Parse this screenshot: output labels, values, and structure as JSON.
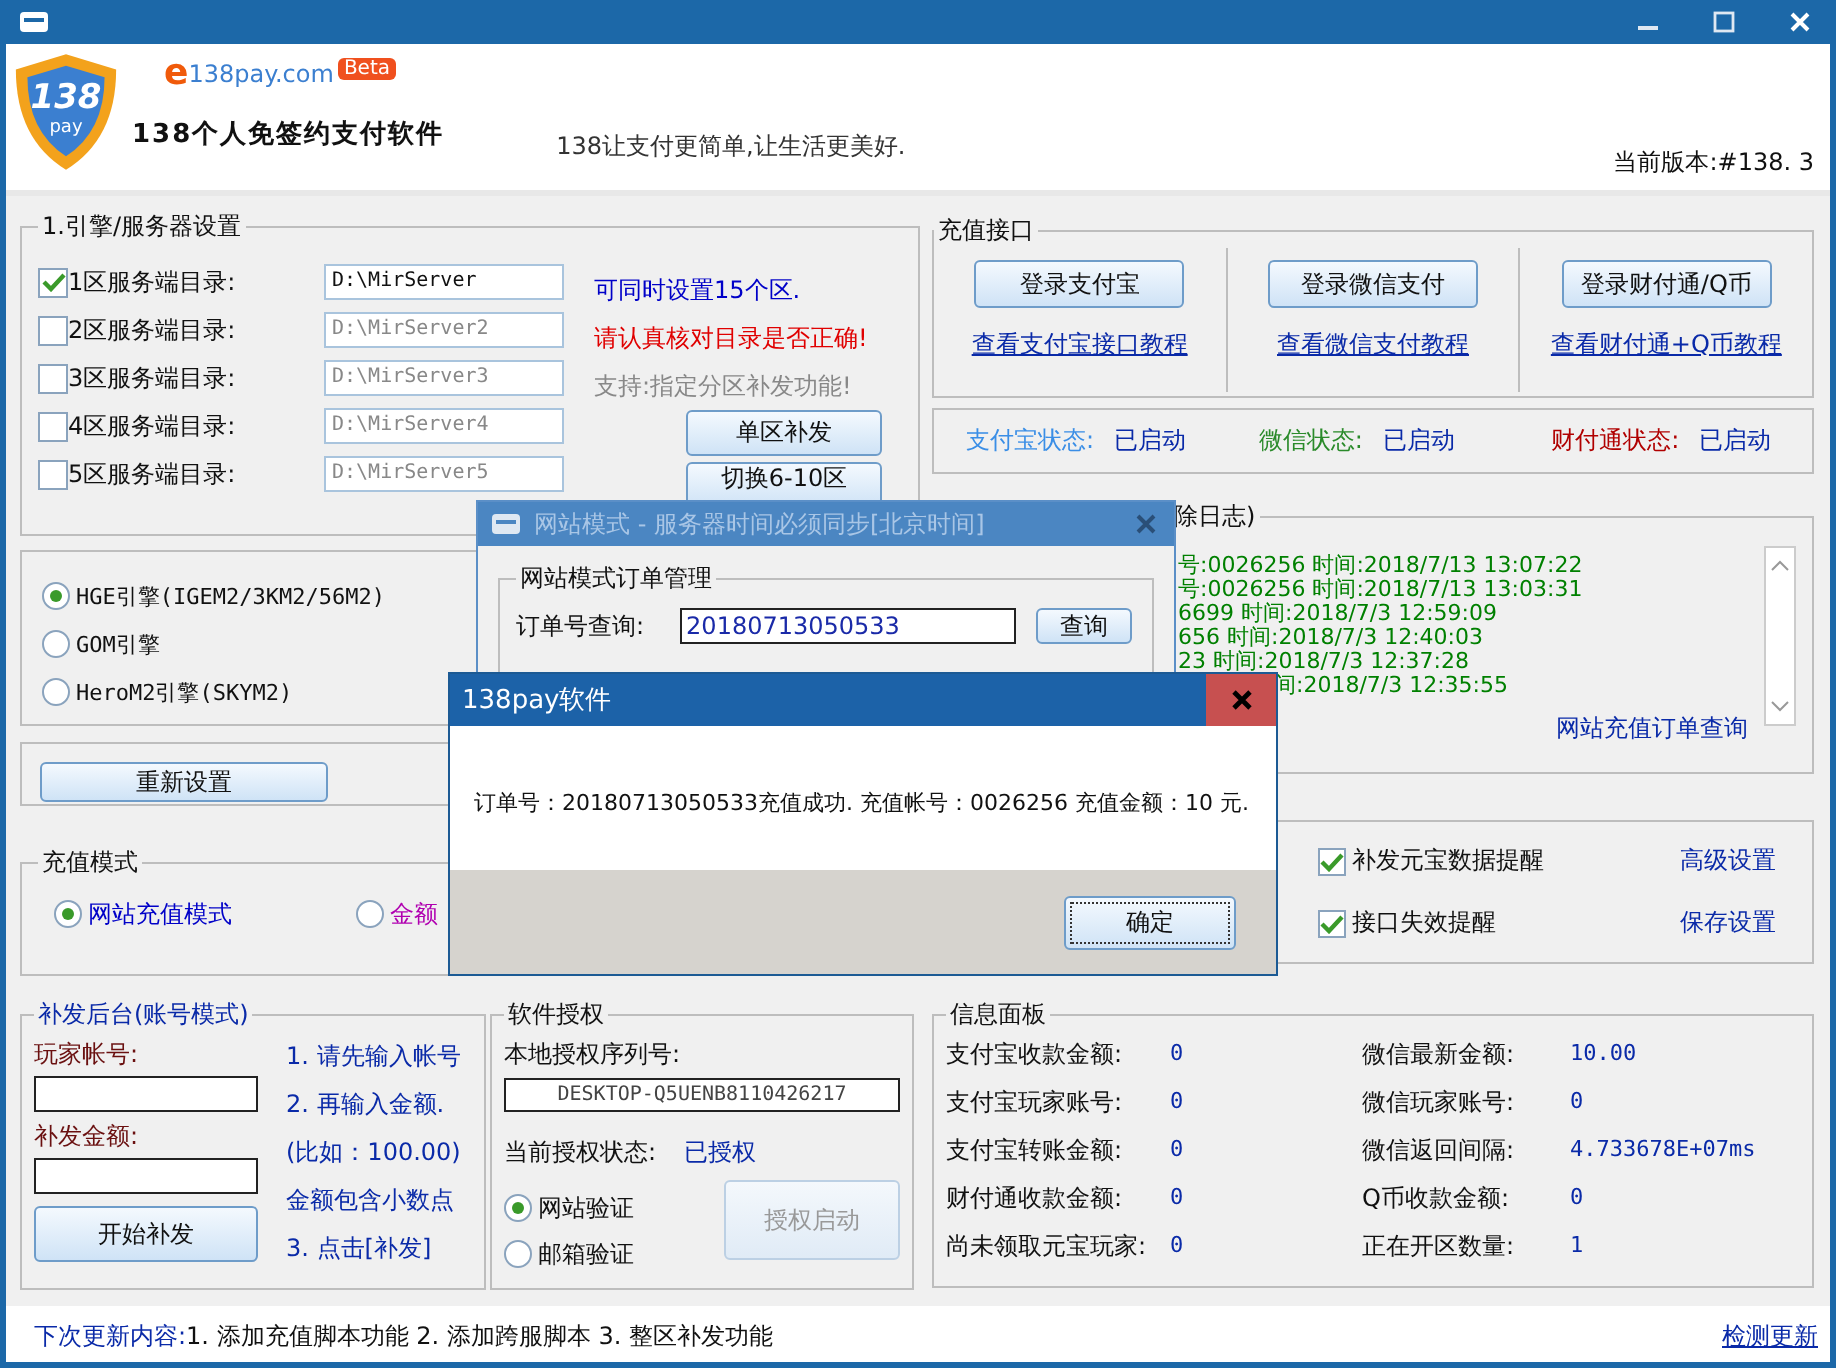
{
  "header": {
    "logo_number": "138",
    "logo_sub": "pay",
    "site_e": "e",
    "site": "138pay.com",
    "beta": "Beta",
    "app_name": "138个人免签约支付软件",
    "slogan": "138让支付更简单,让生活更美好.",
    "version": "当前版本:#138. 3"
  },
  "server_settings": {
    "title": "1.引擎/服务器设置",
    "servers": [
      {
        "label": "1区服务端目录:",
        "path": "D:\\MirServer",
        "checked": true
      },
      {
        "label": "2区服务端目录:",
        "path": "D:\\MirServer2",
        "checked": false
      },
      {
        "label": "3区服务端目录:",
        "path": "D:\\MirServer3",
        "checked": false
      },
      {
        "label": "4区服务端目录:",
        "path": "D:\\MirServer4",
        "checked": false
      },
      {
        "label": "5区服务端目录:",
        "path": "D:\\MirServer5",
        "checked": false
      }
    ],
    "notes": [
      {
        "text": "可同时设置15个区.",
        "kind": "info"
      },
      {
        "text": "请认真核对目录是否正确!",
        "kind": "warning"
      },
      {
        "text": "支持:指定分区补发功能!",
        "kind": "hint"
      }
    ],
    "buttons": [
      "单区补发",
      "切换6-10区"
    ]
  },
  "engines": [
    {
      "label": "HGE引擎(IGEM2/3KM2/56M2)",
      "selected": true
    },
    {
      "label": "GOM引擎",
      "selected": false
    },
    {
      "label": "HeroM2引擎(SKYM2)",
      "selected": false
    }
  ],
  "reset_button": "重新设置",
  "recharge_mode": {
    "title": "充值模式",
    "options": [
      {
        "label": "网站充值模式",
        "selected": true,
        "color": "#0000c8"
      },
      {
        "label": "金额",
        "selected": false,
        "color": "#b000b0"
      }
    ]
  },
  "supplement": {
    "title": "补发后台(账号模式)",
    "account_label": "玩家帐号:",
    "amount_label": "补发金额:",
    "button": "开始补发",
    "steps": [
      "1. 请先输入帐号",
      "2. 再输入金额.",
      "(比如：100.00)",
      "金额包含小数点",
      "3. 点击[补发]"
    ]
  },
  "license": {
    "title": "软件授权",
    "serial_label": "本地授权序列号:",
    "serial": "DESKTOP-Q5UENB8110426217",
    "status_label": "当前授权状态:",
    "status": "已授权",
    "methods": [
      {
        "label": "网站验证",
        "selected": true
      },
      {
        "label": "邮箱验证",
        "selected": false
      }
    ],
    "activate_button": {
      "label": "授权启动",
      "disabled": true
    }
  },
  "payment": {
    "title": "充值接口",
    "channels": [
      {
        "login": "登录支付宝",
        "tutorial": "查看支付宝接口教程",
        "status_label": "支付宝状态:",
        "status": "已启动",
        "color": "#3a8ee6"
      },
      {
        "login": "登录微信支付",
        "tutorial": "查看微信支付教程",
        "status_label": "微信状态:",
        "status": "已启动",
        "color": "#2a8a2a"
      },
      {
        "login": "登录财付通/Q币",
        "tutorial": "查看财付通+Q币教程",
        "status_label": "财付通状态:",
        "status": "已启动",
        "color": "#b00000"
      }
    ]
  },
  "log": {
    "title": "除日志)",
    "lines": [
      "号:0026256 时间:2018/7/13 13:07:22",
      "号:0026256 时间:2018/7/13 13:03:31",
      "6699 时间:2018/7/3 12:59:09",
      "656 时间:2018/7/3 12:40:03",
      "23 时间:2018/7/3 12:37:28",
      "间:2018/7/3 12:35:55"
    ],
    "link": "网站充值订单查询"
  },
  "options": {
    "checks": [
      {
        "label": "补发元宝数据提醒",
        "checked": true
      },
      {
        "label": "接口失效提醒",
        "checked": true
      }
    ],
    "links": [
      "高级设置",
      "保存设置"
    ]
  },
  "info_panel": {
    "title": "信息面板",
    "items": [
      {
        "label": "支付宝收款金额:",
        "value": "0"
      },
      {
        "label": "微信最新金额:",
        "value": "10.00"
      },
      {
        "label": "支付宝玩家账号:",
        "value": "0"
      },
      {
        "label": "微信玩家账号:",
        "value": "0"
      },
      {
        "label": "支付宝转账金额:",
        "value": "0"
      },
      {
        "label": "微信返回间隔:",
        "value": "4.733678E+07ms"
      },
      {
        "label": "财付通收款金额:",
        "value": "0"
      },
      {
        "label": "Q币收款金额:",
        "value": "0"
      },
      {
        "label": "尚未领取元宝玩家:",
        "value": "0"
      },
      {
        "label": "正在开区数量:",
        "value": "1"
      }
    ]
  },
  "status_bar": {
    "prefix": "下次更新内容:",
    "text": "1. 添加充值脚本功能 2. 添加跨服脚本 3. 整区补发功能",
    "link": "检测更新"
  },
  "order_dialog": {
    "title": "网站模式  - 服务器时间必须同步[北京时间]",
    "group": "网站模式订单管理",
    "query_label": "订单号查询:",
    "order_no": "20180713050533",
    "query_button": "查询"
  },
  "message_dialog": {
    "title": "138pay软件",
    "message": "订单号：20180713050533充值成功. 充值帐号：0026256 充值金额：10 元.",
    "ok": "确定"
  }
}
